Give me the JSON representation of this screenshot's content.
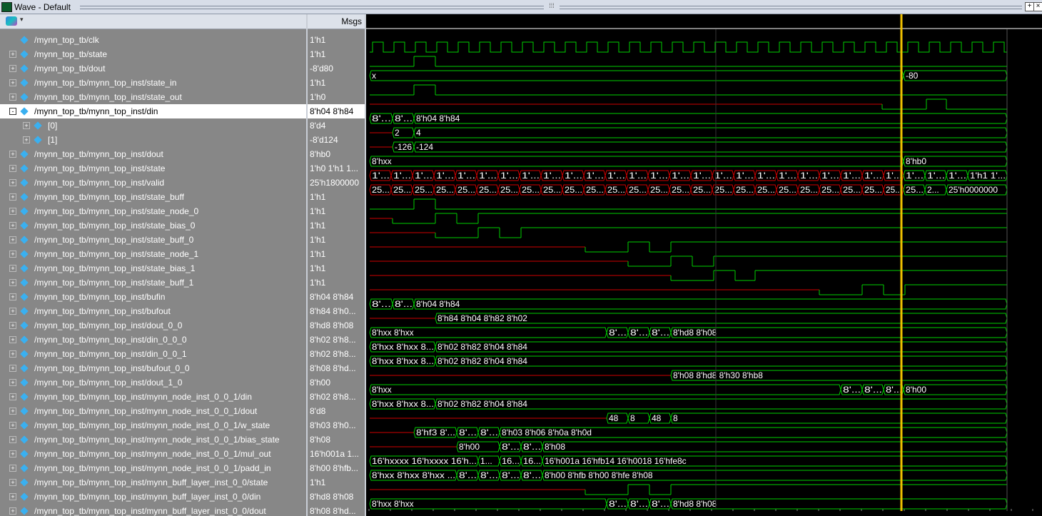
{
  "window": {
    "title": "Wave - Default",
    "controls": [
      "+",
      "×"
    ]
  },
  "header": {
    "msgs_label": "Msgs"
  },
  "colors": {
    "background": "#000000",
    "pane": "#878787",
    "wave_green": "#00d000",
    "wave_red": "#d00000",
    "cursor": "#f0c000"
  },
  "icons": {
    "toolbar": "wave-toolbar-icon",
    "expand": "plus-box-icon",
    "collapse": "minus-box-icon",
    "signal": "diamond-signal-icon"
  },
  "signals": [
    {
      "name": "/mynn_top_tb/clk",
      "value": "1'h1",
      "expander": ""
    },
    {
      "name": "/mynn_top_tb/state",
      "value": "1'h1",
      "expander": "+"
    },
    {
      "name": "/mynn_top_tb/dout",
      "value": "-8'd80",
      "expander": "+"
    },
    {
      "name": "/mynn_top_tb/mynn_top_inst/state_in",
      "value": "1'h1",
      "expander": "+"
    },
    {
      "name": "/mynn_top_tb/mynn_top_inst/state_out",
      "value": "1'h0",
      "expander": "+"
    },
    {
      "name": "/mynn_top_tb/mynn_top_inst/din",
      "value": "8'h04 8'h84",
      "expander": "-",
      "selected": true
    },
    {
      "name": "[0]",
      "value": "8'd4",
      "expander": "+",
      "child": true
    },
    {
      "name": "[1]",
      "value": "-8'd124",
      "expander": "+",
      "child": true
    },
    {
      "name": "/mynn_top_tb/mynn_top_inst/dout",
      "value": "8'hb0",
      "expander": "+"
    },
    {
      "name": "/mynn_top_tb/mynn_top_inst/state",
      "value": "1'h0 1'h1 1...",
      "expander": "+"
    },
    {
      "name": "/mynn_top_tb/mynn_top_inst/valid",
      "value": "25'h1800000",
      "expander": "+"
    },
    {
      "name": "/mynn_top_tb/mynn_top_inst/state_buff",
      "value": "1'h1",
      "expander": "+"
    },
    {
      "name": "/mynn_top_tb/mynn_top_inst/state_node_0",
      "value": "1'h1",
      "expander": "+"
    },
    {
      "name": "/mynn_top_tb/mynn_top_inst/state_bias_0",
      "value": "1'h1",
      "expander": "+"
    },
    {
      "name": "/mynn_top_tb/mynn_top_inst/state_buff_0",
      "value": "1'h1",
      "expander": "+"
    },
    {
      "name": "/mynn_top_tb/mynn_top_inst/state_node_1",
      "value": "1'h1",
      "expander": "+"
    },
    {
      "name": "/mynn_top_tb/mynn_top_inst/state_bias_1",
      "value": "1'h1",
      "expander": "+"
    },
    {
      "name": "/mynn_top_tb/mynn_top_inst/state_buff_1",
      "value": "1'h1",
      "expander": "+"
    },
    {
      "name": "/mynn_top_tb/mynn_top_inst/bufin",
      "value": "8'h04 8'h84",
      "expander": "+"
    },
    {
      "name": "/mynn_top_tb/mynn_top_inst/bufout",
      "value": "8'h84 8'h0...",
      "expander": "+"
    },
    {
      "name": "/mynn_top_tb/mynn_top_inst/dout_0_0",
      "value": "8'hd8 8'h08",
      "expander": "+"
    },
    {
      "name": "/mynn_top_tb/mynn_top_inst/din_0_0_0",
      "value": "8'h02 8'h8...",
      "expander": "+"
    },
    {
      "name": "/mynn_top_tb/mynn_top_inst/din_0_0_1",
      "value": "8'h02 8'h8...",
      "expander": "+"
    },
    {
      "name": "/mynn_top_tb/mynn_top_inst/bufout_0_0",
      "value": "8'h08 8'hd...",
      "expander": "+"
    },
    {
      "name": "/mynn_top_tb/mynn_top_inst/dout_1_0",
      "value": "8'h00",
      "expander": "+"
    },
    {
      "name": "/mynn_top_tb/mynn_top_inst/mynn_node_inst_0_0_1/din",
      "value": "8'h02 8'h8...",
      "expander": "+"
    },
    {
      "name": "/mynn_top_tb/mynn_top_inst/mynn_node_inst_0_0_1/dout",
      "value": "8'd8",
      "expander": "+"
    },
    {
      "name": "/mynn_top_tb/mynn_top_inst/mynn_node_inst_0_0_1/w_state",
      "value": "8'h03 8'h0...",
      "expander": "+"
    },
    {
      "name": "/mynn_top_tb/mynn_top_inst/mynn_node_inst_0_0_1/bias_state",
      "value": "8'h08",
      "expander": "+"
    },
    {
      "name": "/mynn_top_tb/mynn_top_inst/mynn_node_inst_0_0_1/mul_out",
      "value": "16'h001a 1...",
      "expander": "+"
    },
    {
      "name": "/mynn_top_tb/mynn_top_inst/mynn_node_inst_0_0_1/padd_in",
      "value": "8'h00 8'hfb...",
      "expander": "+"
    },
    {
      "name": "/mynn_top_tb/mynn_top_inst/mynn_buff_layer_inst_0_0/state",
      "value": "1'h1",
      "expander": "+"
    },
    {
      "name": "/mynn_top_tb/mynn_top_inst/mynn_buff_layer_inst_0_0/din",
      "value": "8'hd8 8'h08",
      "expander": "+"
    },
    {
      "name": "/mynn_top_tb/mynn_top_inst/mynn_buff_layer_inst_0_0/dout",
      "value": "8'h08 8'hd...",
      "expander": "+"
    }
  ],
  "waves": [
    {
      "kind": "clock",
      "period": 30,
      "first": 4,
      "until": 898
    },
    {
      "kind": "logic",
      "pts": [
        [
          0,
          "L"
        ],
        [
          62,
          "H"
        ],
        [
          92,
          "L"
        ]
      ],
      "init": "L"
    },
    {
      "kind": "bus",
      "segs": [
        [
          0,
          "x"
        ],
        [
          748,
          "-80"
        ]
      ]
    },
    {
      "kind": "logic",
      "pts": [
        [
          0,
          "L"
        ],
        [
          62,
          "H"
        ],
        [
          92,
          "L"
        ]
      ]
    },
    {
      "kind": "logic",
      "pts": [
        [
          0,
          "R"
        ],
        [
          718,
          "L"
        ],
        [
          780,
          "H"
        ],
        [
          808,
          "L"
        ]
      ]
    },
    {
      "kind": "bus",
      "segs": [
        [
          0,
          "8'..."
        ],
        [
          32,
          "8'..."
        ],
        [
          62,
          "8'h04 8'h84"
        ]
      ]
    },
    {
      "kind": "bus",
      "segs": [
        [
          0,
          ""
        ],
        [
          32,
          "2"
        ],
        [
          62,
          "4"
        ]
      ],
      "redstart": true
    },
    {
      "kind": "bus",
      "segs": [
        [
          0,
          ""
        ],
        [
          32,
          "-126"
        ],
        [
          62,
          "-124"
        ]
      ],
      "redstart": true
    },
    {
      "kind": "bus",
      "segs": [
        [
          0,
          "8'hxx"
        ],
        [
          748,
          "8'hb0"
        ]
      ]
    },
    {
      "kind": "busred",
      "step": 30,
      "first": 0,
      "text": "1'...",
      "until": 748,
      "after": [
        [
          748,
          "1'..."
        ],
        [
          778,
          "1'..."
        ],
        [
          808,
          "1'..."
        ],
        [
          838,
          "1'h1 1'..."
        ]
      ]
    },
    {
      "kind": "busred",
      "step": 30,
      "first": 0,
      "text": "25...",
      "until": 748,
      "after": [
        [
          748,
          "25..."
        ],
        [
          778,
          "2..."
        ],
        [
          808,
          "25'h0000000"
        ]
      ]
    },
    {
      "kind": "logic",
      "pts": [
        [
          0,
          "L"
        ],
        [
          62,
          "H"
        ],
        [
          92,
          "L"
        ]
      ]
    },
    {
      "kind": "logic",
      "pts": [
        [
          0,
          "R"
        ],
        [
          32,
          "L"
        ],
        [
          92,
          "H"
        ],
        [
          122,
          "L"
        ],
        [
          152,
          "H"
        ]
      ]
    },
    {
      "kind": "logic",
      "pts": [
        [
          0,
          "R"
        ],
        [
          92,
          "L"
        ],
        [
          152,
          "H"
        ],
        [
          182,
          "L"
        ],
        [
          212,
          "H"
        ]
      ]
    },
    {
      "kind": "logic",
      "pts": [
        [
          0,
          "R"
        ],
        [
          302,
          "L"
        ],
        [
          362,
          "H"
        ],
        [
          392,
          "L"
        ],
        [
          422,
          "H"
        ]
      ]
    },
    {
      "kind": "logic",
      "pts": [
        [
          0,
          "R"
        ],
        [
          362,
          "L"
        ],
        [
          422,
          "H"
        ],
        [
          452,
          "L"
        ],
        [
          482,
          "H"
        ]
      ]
    },
    {
      "kind": "logic",
      "pts": [
        [
          0,
          "R"
        ],
        [
          422,
          "L"
        ],
        [
          482,
          "H"
        ],
        [
          512,
          "L"
        ],
        [
          540,
          "H"
        ]
      ]
    },
    {
      "kind": "logic",
      "pts": [
        [
          0,
          "R"
        ],
        [
          630,
          "L"
        ],
        [
          690,
          "H"
        ],
        [
          720,
          "L"
        ],
        [
          750,
          "H"
        ]
      ]
    },
    {
      "kind": "bus",
      "segs": [
        [
          0,
          "8'..."
        ],
        [
          32,
          "8'..."
        ],
        [
          62,
          "8'h04 8'h84"
        ]
      ]
    },
    {
      "kind": "bus",
      "segs": [
        [
          0,
          ""
        ],
        [
          92,
          "8'h84 8'h04 8'h82 8'h02"
        ]
      ],
      "redstart": true
    },
    {
      "kind": "bus",
      "segs": [
        [
          0,
          "8'hxx 8'hxx"
        ],
        [
          332,
          "8'..."
        ],
        [
          362,
          "8'..."
        ],
        [
          392,
          "8'..."
        ],
        [
          422,
          "8'hd8 8'h08"
        ]
      ]
    },
    {
      "kind": "bus",
      "segs": [
        [
          0,
          "8'hxx 8'hxx 8..."
        ],
        [
          92,
          "8'h02 8'h82 8'h04 8'h84"
        ]
      ]
    },
    {
      "kind": "bus",
      "segs": [
        [
          0,
          "8'hxx 8'hxx 8..."
        ],
        [
          92,
          "8'h02 8'h82 8'h04 8'h84"
        ]
      ]
    },
    {
      "kind": "bus",
      "segs": [
        [
          0,
          ""
        ],
        [
          422,
          "8'h08 8'hd8 8'h30 8'hb8"
        ]
      ],
      "redstart": true
    },
    {
      "kind": "bus",
      "segs": [
        [
          0,
          "8'hxx"
        ],
        [
          660,
          "8'..."
        ],
        [
          690,
          "8'..."
        ],
        [
          720,
          "8'..."
        ],
        [
          748,
          "8'h00"
        ]
      ]
    },
    {
      "kind": "bus",
      "segs": [
        [
          0,
          "8'hxx 8'hxx 8..."
        ],
        [
          92,
          "8'h02 8'h82 8'h04 8'h84"
        ]
      ]
    },
    {
      "kind": "bus",
      "segs": [
        [
          0,
          ""
        ],
        [
          332,
          "48"
        ],
        [
          362,
          "8"
        ],
        [
          392,
          "48"
        ],
        [
          422,
          "8"
        ]
      ],
      "redstart": true
    },
    {
      "kind": "bus",
      "segs": [
        [
          0,
          ""
        ],
        [
          62,
          "8'hf3 8'..."
        ],
        [
          122,
          "8'..."
        ],
        [
          152,
          "8'..."
        ],
        [
          182,
          "8'h03 8'h06 8'h0a 8'h0d"
        ]
      ],
      "redstart": true
    },
    {
      "kind": "bus",
      "segs": [
        [
          0,
          ""
        ],
        [
          122,
          "8'h00"
        ],
        [
          182,
          "8'..."
        ],
        [
          212,
          "8'..."
        ],
        [
          242,
          "8'h08"
        ]
      ],
      "redstart": true
    },
    {
      "kind": "bus",
      "segs": [
        [
          0,
          "16'hxxxx 16'hxxxx 16'h..."
        ],
        [
          152,
          "1..."
        ],
        [
          182,
          "16..."
        ],
        [
          212,
          "16..."
        ],
        [
          242,
          "16'h001a 16'hfb14 16'h0018 16'hfe8c"
        ]
      ]
    },
    {
      "kind": "bus",
      "segs": [
        [
          0,
          "8'hxx 8'hxx 8'hxx ..."
        ],
        [
          122,
          "8'..."
        ],
        [
          152,
          "8'..."
        ],
        [
          182,
          "8'..."
        ],
        [
          212,
          "8'..."
        ],
        [
          242,
          "8'h00 8'hfb 8'h00 8'hfe 8'h08"
        ]
      ]
    },
    {
      "kind": "logic",
      "pts": [
        [
          0,
          "R"
        ],
        [
          302,
          "L"
        ],
        [
          362,
          "H"
        ],
        [
          392,
          "L"
        ],
        [
          422,
          "H"
        ]
      ]
    },
    {
      "kind": "bus",
      "segs": [
        [
          0,
          "8'hxx 8'hxx"
        ],
        [
          332,
          "8'..."
        ],
        [
          362,
          "8'..."
        ],
        [
          392,
          "8'..."
        ],
        [
          422,
          "8'hd8 8'h08"
        ]
      ]
    },
    {
      "kind": "bus",
      "segs": [
        [
          0,
          ""
        ],
        [
          422,
          "8'h08 8'hd8 8'h30 8'hb8"
        ]
      ],
      "redstart": true
    }
  ]
}
